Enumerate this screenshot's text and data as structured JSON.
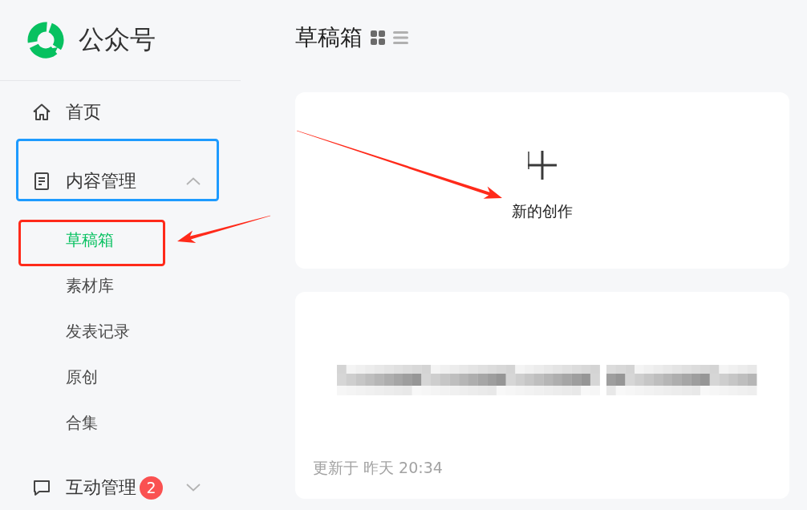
{
  "sidebar": {
    "logo": {
      "title": "公众号"
    },
    "items": [
      {
        "kind": "home",
        "label": "首页",
        "selected": false
      },
      {
        "kind": "document",
        "label": "内容管理",
        "selected": false,
        "expanded": true,
        "children": [
          {
            "label": "草稿箱",
            "selected": true
          },
          {
            "label": "素材库",
            "selected": false
          },
          {
            "label": "发表记录",
            "selected": false
          },
          {
            "label": "原创",
            "selected": false
          },
          {
            "label": "合集",
            "selected": false
          }
        ]
      },
      {
        "kind": "chat",
        "label": "互动管理",
        "selected": false,
        "expanded": false,
        "badge": "2"
      }
    ]
  },
  "main": {
    "title": "草稿箱",
    "view_modes": [
      {
        "kind": "grid",
        "selected": true
      },
      {
        "kind": "list",
        "selected": false
      }
    ],
    "new_draft": {
      "label": "新的创作"
    },
    "drafts": [
      {
        "updated": "更新于 昨天 20:34"
      }
    ]
  },
  "annotations": [
    {
      "kind": "frame",
      "color": "#1e9bff"
    },
    {
      "kind": "frame",
      "color": "#ff2a1a"
    },
    {
      "kind": "arrow",
      "color": "#ff2a1a"
    },
    {
      "kind": "arrow",
      "color": "#ff2a1a"
    }
  ]
}
